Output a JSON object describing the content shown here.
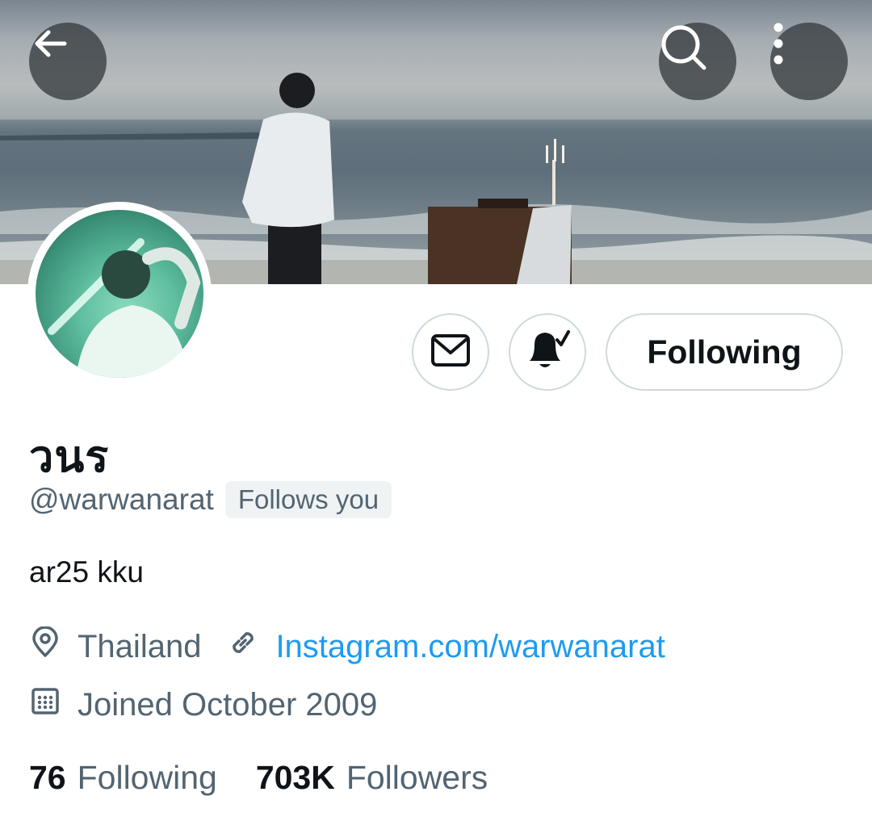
{
  "header": {
    "back_icon": "arrow-left-icon",
    "search_icon": "search-icon",
    "more_icon": "more-vertical-icon"
  },
  "actions": {
    "message_icon": "envelope-icon",
    "notify_icon": "bell-check-icon",
    "follow_label": "Following"
  },
  "profile": {
    "display_name": "วนร",
    "handle": "@warwanarat",
    "follows_you": "Follows you",
    "bio": "ar25 kku",
    "location": "Thailand",
    "website": "Instagram.com/warwanarat",
    "joined": "Joined October 2009"
  },
  "stats": {
    "following_count": "76",
    "following_label": "Following",
    "followers_count": "703K",
    "followers_label": "Followers"
  },
  "colors": {
    "text_primary": "#0f1419",
    "text_secondary": "#536471",
    "link": "#1d9bf0",
    "border": "#cfd9de"
  }
}
